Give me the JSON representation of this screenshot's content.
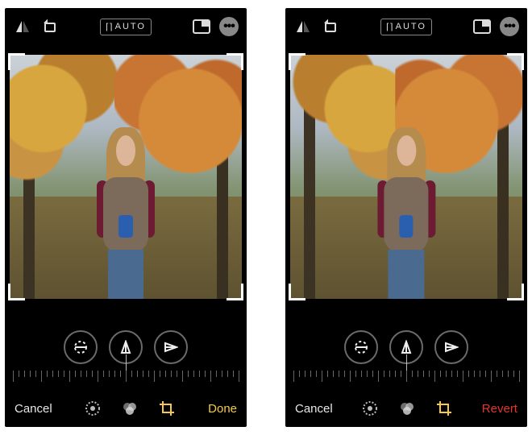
{
  "screens": [
    {
      "mirrored": false,
      "topbar": {
        "auto_label": "AUTO"
      },
      "bottombar": {
        "left": "Cancel",
        "right": "Done",
        "right_style": "done"
      }
    },
    {
      "mirrored": true,
      "topbar": {
        "auto_label": "AUTO"
      },
      "bottombar": {
        "left": "Cancel",
        "right": "Revert",
        "right_style": "revert"
      }
    }
  ],
  "ruler": {
    "tick_count": 41,
    "pointer_position": 0.5
  }
}
